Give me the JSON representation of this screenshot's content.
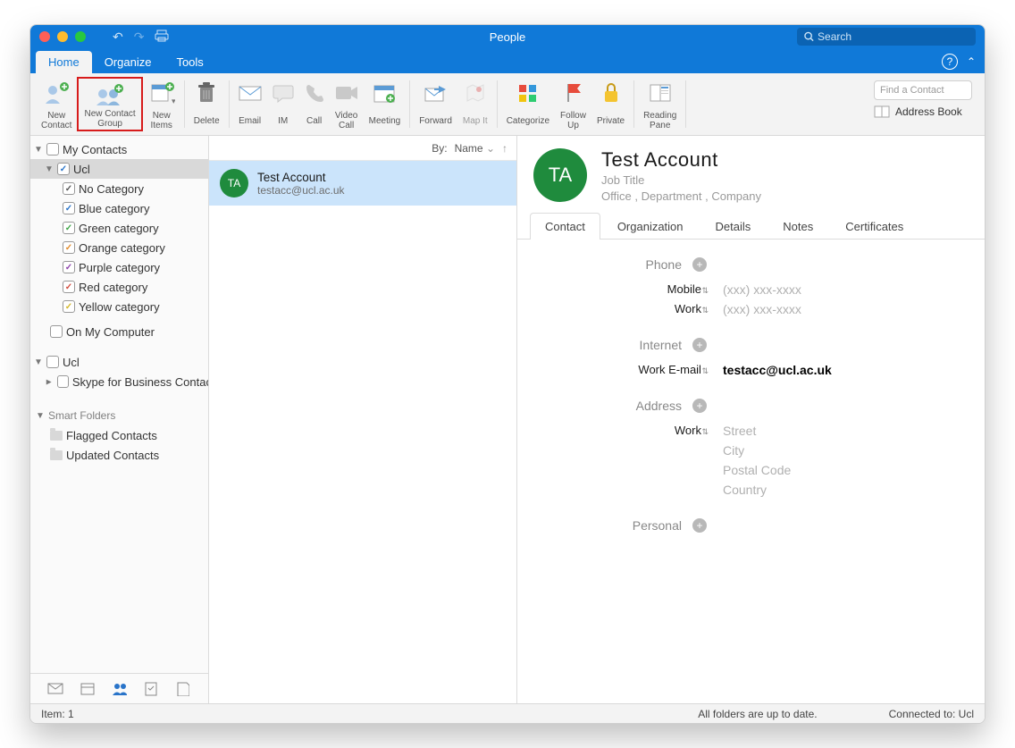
{
  "window": {
    "title": "People",
    "search_placeholder": "Search"
  },
  "tabs": {
    "home": "Home",
    "organize": "Organize",
    "tools": "Tools"
  },
  "ribbon": {
    "new_contact": "New\nContact",
    "new_contact_group": "New Contact\nGroup",
    "new_items": "New\nItems",
    "delete": "Delete",
    "email": "Email",
    "im": "IM",
    "call": "Call",
    "video_call": "Video\nCall",
    "meeting": "Meeting",
    "forward": "Forward",
    "map_it": "Map It",
    "categorize": "Categorize",
    "follow_up": "Follow\nUp",
    "private": "Private",
    "reading_pane": "Reading\nPane",
    "find_contact": "Find a Contact",
    "address_book": "Address Book"
  },
  "nav": {
    "my_contacts": "My Contacts",
    "ucl": "Ucl",
    "no_category": "No Category",
    "blue": "Blue category",
    "green": "Green category",
    "orange": "Orange category",
    "purple": "Purple category",
    "red": "Red category",
    "yellow": "Yellow category",
    "on_my_computer": "On My Computer",
    "ucl2": "Ucl",
    "skype": "Skype for Business Contacts",
    "smart_folders": "Smart Folders",
    "flagged": "Flagged Contacts",
    "updated": "Updated Contacts"
  },
  "sort": {
    "by_label": "By:",
    "by_value": "Name"
  },
  "list": {
    "items": [
      {
        "initials": "TA",
        "name": "Test Account",
        "email": "testacc@ucl.ac.uk"
      }
    ]
  },
  "detail": {
    "initials": "TA",
    "name": "Test  Account",
    "job_title": "Job Title",
    "office": "Office",
    "department": "Department",
    "company": "Company",
    "tabs": {
      "contact": "Contact",
      "organization": "Organization",
      "details": "Details",
      "notes": "Notes",
      "certificates": "Certificates"
    },
    "sections": {
      "phone": "Phone",
      "mobile_lbl": "Mobile",
      "work_phone_lbl": "Work",
      "phone_placeholder": "(xxx) xxx-xxxx",
      "internet": "Internet",
      "work_email_lbl": "Work E-mail",
      "work_email_val": "testacc@ucl.ac.uk",
      "address": "Address",
      "addr_work_lbl": "Work",
      "street": "Street",
      "city": "City",
      "postal": "Postal Code",
      "country": "Country",
      "personal": "Personal"
    }
  },
  "status": {
    "item": "Item: 1",
    "sync": "All folders are up to date.",
    "conn": "Connected to: Ucl"
  }
}
